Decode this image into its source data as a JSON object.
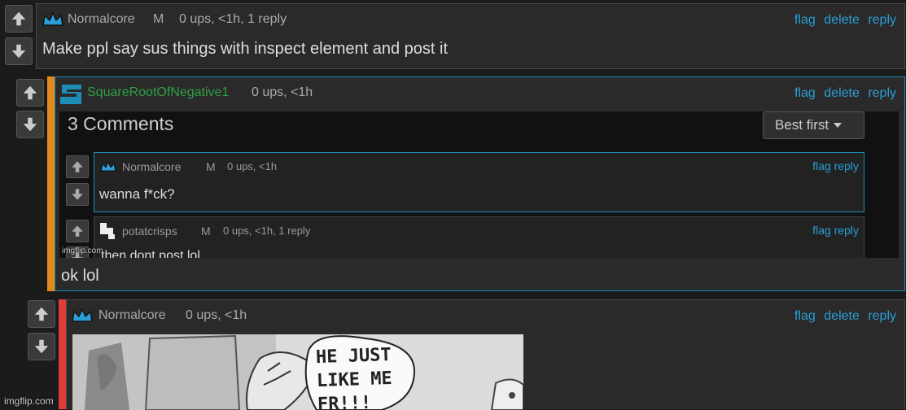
{
  "colors": {
    "accent": "#2a9fd6",
    "green": "#2ea043",
    "orange": "#e08a1e",
    "red": "#e03c3c"
  },
  "actions": {
    "flag": "flag",
    "delete": "delete",
    "reply": "reply"
  },
  "comments": [
    {
      "user": "Normalcore",
      "mod_badge": "M",
      "meta": "0 ups, <1h, 1 reply",
      "text": "Make ppl say sus things with inspect element and post it",
      "icon": "crown-icon"
    },
    {
      "user": "SquareRootOfNegative1",
      "meta": "0 ups, <1h",
      "text": "ok lol",
      "icon": "s-logo-icon"
    },
    {
      "user": "Normalcore",
      "mod_badge": "M",
      "meta": "0 ups, <1h",
      "text": "",
      "icon": "crown-icon"
    }
  ],
  "screenshot": {
    "header": "3 Comments",
    "sort_label": "Best first",
    "items": [
      {
        "user": "Normalcore",
        "mod_badge": "M",
        "meta": "0 ups, <1h",
        "text": "wanna f*ck?",
        "actions": "flag reply"
      },
      {
        "user": "potatcrisps",
        "mod_badge": "M",
        "meta": "0 ups, <1h, 1 reply",
        "text": "then dont post lol",
        "actions": "flag reply"
      }
    ],
    "watermark": "imgflip.com"
  },
  "manga": {
    "speech": "HE JUST LIKE ME FR!!!"
  },
  "page_watermark": "imgflip.com"
}
